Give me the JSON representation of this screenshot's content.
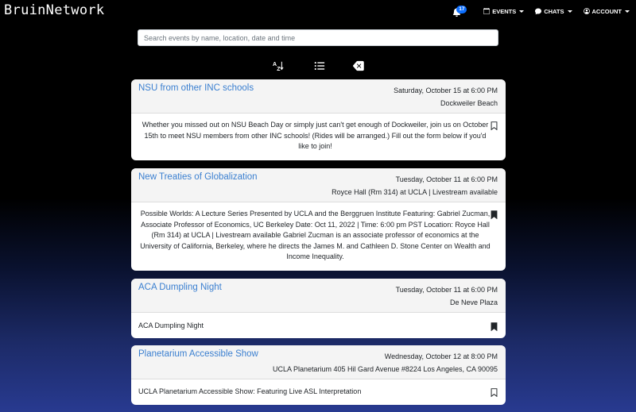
{
  "app": {
    "brand": "BruinNetwork"
  },
  "nav": {
    "notifications_count": "17",
    "events_label": "EVENTS",
    "chats_label": "CHATS",
    "account_label": "ACCOUNT"
  },
  "search": {
    "placeholder": "Search events by name, location, date and time",
    "value": ""
  },
  "toolbar": {
    "sort_icon": "sort-alpha-icon",
    "list_icon": "list-icon",
    "clear_icon": "backspace-icon"
  },
  "events": [
    {
      "title": "NSU from other INC schools",
      "date": "Saturday, October 15 at 6:00 PM",
      "location": "Dockweiler Beach",
      "description": "Whether you missed out on NSU Beach Day or simply just can't get enough of Dockweiler, join us on October 15th to meet NSU members from other INC schools! (Rides will be arranged.) Fill out the form below if you'd like to join!",
      "bookmarked": false
    },
    {
      "title": "New Treaties of Globalization",
      "date": "Tuesday, October 11 at 6:00 PM",
      "location": "Royce Hall (Rm 314) at UCLA | Livestream available",
      "description": "Possible Worlds: A Lecture Series Presented by UCLA and the Berggruen Institute Featuring: Gabriel Zucman, Associate Professor of Economics, UC Berkeley Date: Oct 11, 2022 | Time: 6:00 pm PST Location: Royce Hall (Rm 314) at UCLA | Livestream available Gabriel Zucman is an associate professor of economics at the University of California, Berkeley, where he directs the James M. and Cathleen D. Stone Center on Wealth and Income Inequality.",
      "bookmarked": true
    },
    {
      "title": "ACA Dumpling Night",
      "date": "Tuesday, October 11 at 6:00 PM",
      "location": "De Neve Plaza",
      "description": "ACA Dumpling Night",
      "bookmarked": true
    },
    {
      "title": "Planetarium Accessible Show",
      "date": "Wednesday, October 12 at 8:00 PM",
      "location": "UCLA Planetarium 405 Hil Gard Avenue #8224 Los Angeles, CA 90095",
      "description": "UCLA Planetarium Accessible Show: Featuring Live ASL Interpretation",
      "bookmarked": false
    }
  ],
  "colors": {
    "title_link": "#3a7fd0",
    "badge": "#0d6efd"
  }
}
